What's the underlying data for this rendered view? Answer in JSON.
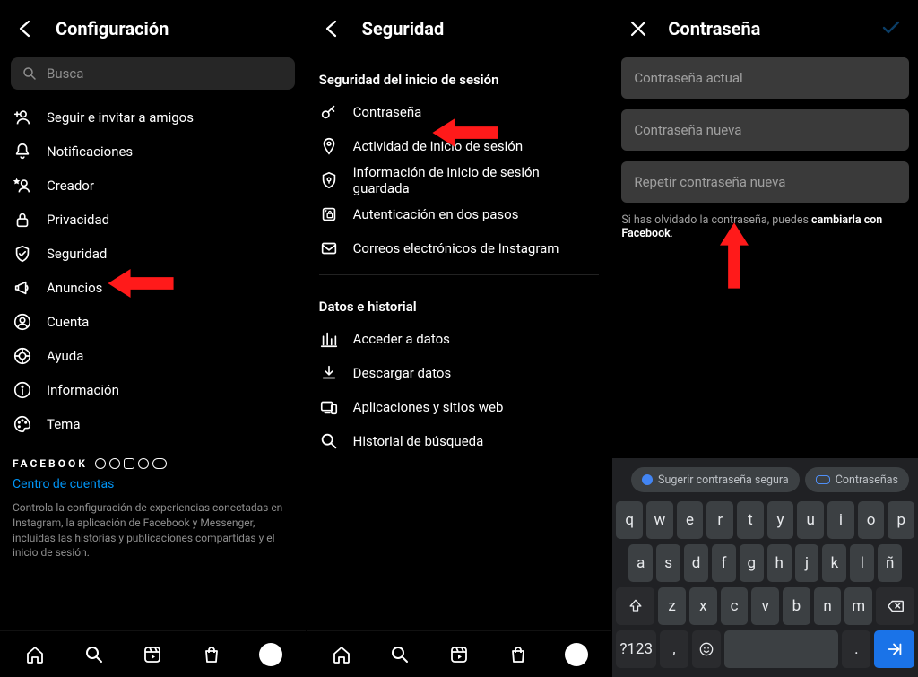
{
  "panel1": {
    "title": "Configuración",
    "search_placeholder": "Busca",
    "items": [
      {
        "icon": "add-user",
        "label": "Seguir e invitar a amigos"
      },
      {
        "icon": "bell",
        "label": "Notificaciones"
      },
      {
        "icon": "star-user",
        "label": "Creador"
      },
      {
        "icon": "lock",
        "label": "Privacidad"
      },
      {
        "icon": "shield",
        "label": "Seguridad"
      },
      {
        "icon": "megaphone",
        "label": "Anuncios"
      },
      {
        "icon": "account",
        "label": "Cuenta"
      },
      {
        "icon": "lifebuoy",
        "label": "Ayuda"
      },
      {
        "icon": "info",
        "label": "Información"
      },
      {
        "icon": "palette",
        "label": "Tema"
      }
    ],
    "fb_brand": "FACEBOOK",
    "accounts_center": "Centro de cuentas",
    "accounts_blurb": "Controla la configuración de experiencias conectadas en Instagram, la aplicación de Facebook y Messenger, incluidas las historias y publicaciones compartidas y el inicio de sesión."
  },
  "panel2": {
    "title": "Seguridad",
    "sec1_title": "Seguridad del inicio de sesión",
    "sec1_items": [
      {
        "icon": "key",
        "label": "Contraseña"
      },
      {
        "icon": "pin",
        "label": "Actividad de inicio de sesión"
      },
      {
        "icon": "keyhole",
        "label": "Información de inicio de sesión guardada"
      },
      {
        "icon": "shield-lock",
        "label": "Autenticación en dos pasos"
      },
      {
        "icon": "mail",
        "label": "Correos electrónicos de Instagram"
      }
    ],
    "sec2_title": "Datos e historial",
    "sec2_items": [
      {
        "icon": "chart",
        "label": "Acceder a datos"
      },
      {
        "icon": "download",
        "label": "Descargar datos"
      },
      {
        "icon": "devices",
        "label": "Aplicaciones y sitios web"
      },
      {
        "icon": "search",
        "label": "Historial de búsqueda"
      }
    ]
  },
  "panel3": {
    "title": "Contraseña",
    "fields": {
      "current": "Contraseña actual",
      "new": "Contraseña nueva",
      "repeat": "Repetir contraseña nueva"
    },
    "forgot_prefix": "Si has olvidado la contraseña, puedes ",
    "forgot_bold": "cambiarla con Facebook",
    "forgot_suffix": "."
  },
  "keyboard": {
    "suggest_secure": "Sugerir contraseña segura",
    "passwords": "Contraseñas",
    "row1": [
      "q",
      "w",
      "e",
      "r",
      "t",
      "y",
      "u",
      "i",
      "o",
      "p"
    ],
    "row2": [
      "a",
      "s",
      "d",
      "f",
      "g",
      "h",
      "j",
      "k",
      "l",
      "ñ"
    ],
    "row3": [
      "z",
      "x",
      "c",
      "v",
      "b",
      "n",
      "m"
    ],
    "numkey": "?123",
    "comma": ",",
    "period": "."
  }
}
